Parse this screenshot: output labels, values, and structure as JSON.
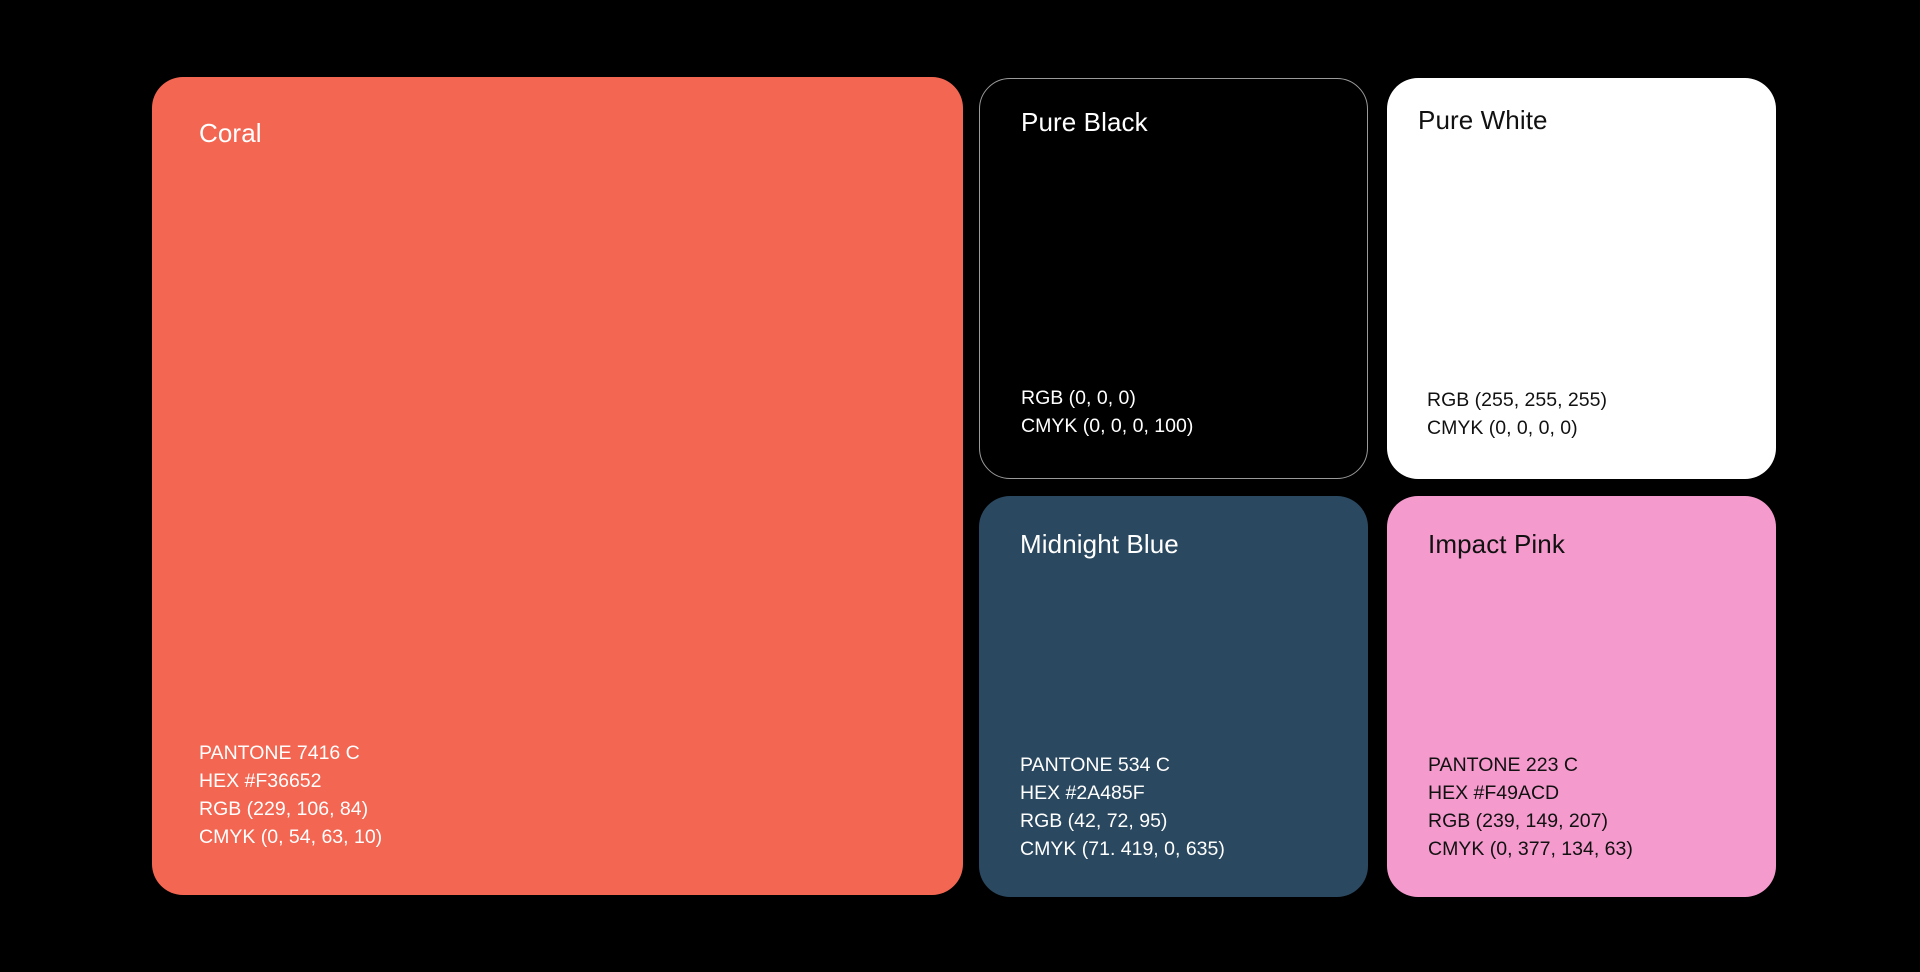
{
  "page": {
    "background": "#000000"
  },
  "swatches": {
    "coral": {
      "name": "Coral",
      "color": "#F36652",
      "text_color": "#FFFFFF",
      "pantone": "PANTONE 7416 C",
      "hex": "HEX #F36652",
      "rgb": "RGB (229, 106, 84)",
      "cmyk": "CMYK (0, 54, 63, 10)"
    },
    "pure_black": {
      "name": "Pure Black",
      "color": "#000000",
      "text_color": "#FFFFFF",
      "rgb": "RGB (0, 0, 0)",
      "cmyk": "CMYK (0, 0, 0, 100)"
    },
    "pure_white": {
      "name": "Pure White",
      "color": "#FFFFFF",
      "text_color": "#111111",
      "rgb": "RGB (255, 255, 255)",
      "cmyk": "CMYK (0, 0, 0, 0)"
    },
    "midnight_blue": {
      "name": "Midnight Blue",
      "color": "#2A485F",
      "text_color": "#FFFFFF",
      "pantone": "PANTONE 534 C",
      "hex": "HEX #2A485F",
      "rgb": "RGB (42, 72, 95)",
      "cmyk": "CMYK (71. 419, 0, 635)"
    },
    "impact_pink": {
      "name": "Impact Pink",
      "color": "#F49ACD",
      "text_color": "#111111",
      "pantone": "PANTONE 223 C",
      "hex": "HEX #F49ACD",
      "rgb": "RGB (239, 149, 207)",
      "cmyk": "CMYK (0, 377, 134, 63)"
    }
  }
}
